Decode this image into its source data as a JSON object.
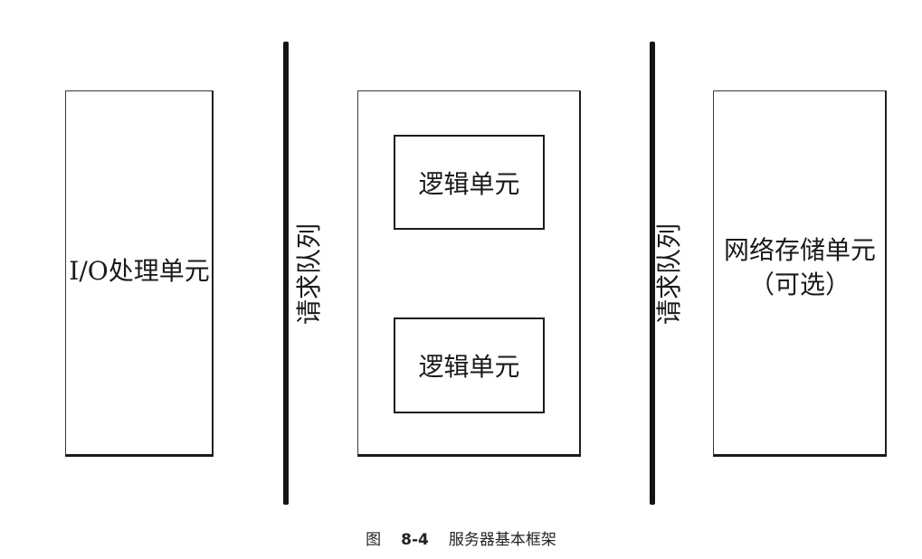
{
  "diagram": {
    "io_unit": {
      "label": "I/O处理单元"
    },
    "queue_left": {
      "label": "请求队列"
    },
    "logic_container": {
      "units": [
        {
          "label": "逻辑单元"
        },
        {
          "label": "逻辑单元"
        }
      ]
    },
    "queue_right": {
      "label": "请求队列"
    },
    "storage_unit": {
      "line1": "网络存储单元",
      "line2": "（可选）"
    }
  },
  "caption": {
    "figure_word": "图",
    "figure_number": "8-4",
    "title": "服务器基本框架"
  }
}
